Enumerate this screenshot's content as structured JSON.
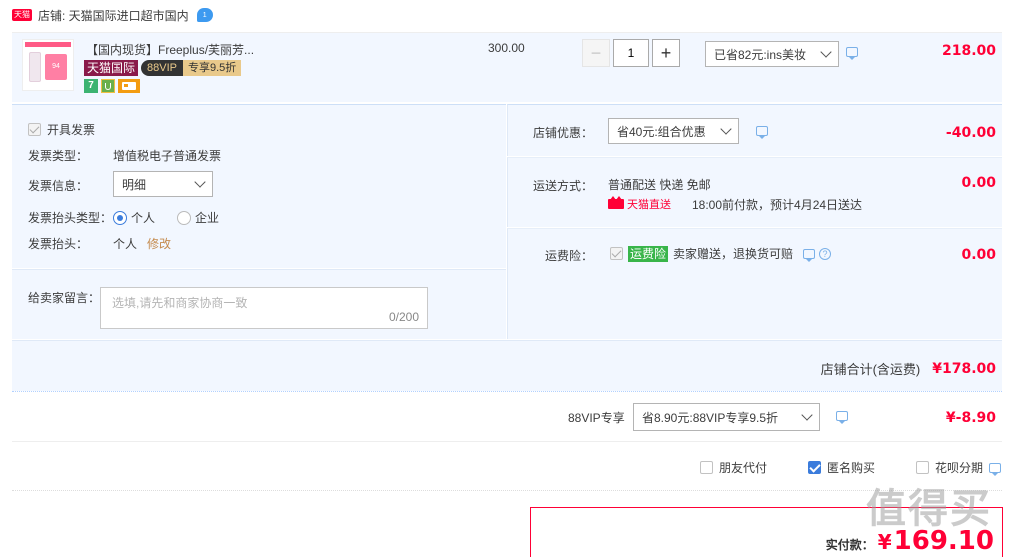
{
  "shop": {
    "badge": "天猫",
    "label": "店铺: 天猫国际进口超市国内",
    "msg_count": "1"
  },
  "item": {
    "title": "【国内现货】Freeplus/芙丽芳...",
    "tag_tmall_intl": "天猫国际",
    "tag_88vip": "88VIP",
    "tag_discount": "专享9.5折",
    "thumb_text": "94",
    "unit_price": "300.00",
    "qty": "1",
    "promo_select": "已省82元:ins美妆",
    "subtotal": "218.00"
  },
  "invoice": {
    "checkbox_label": "开具发票",
    "type_label": "发票类型：",
    "type_value": "增值税电子普通发票",
    "info_label": "发票信息：",
    "info_value": "明细",
    "title_type_label": "发票抬头类型：",
    "option_personal": "个人",
    "option_company": "企业",
    "title_label": "发票抬头：",
    "title_value": "个人",
    "modify_link": "修改"
  },
  "message": {
    "label": "给卖家留言：",
    "placeholder": "选填,请先和商家协商一致",
    "counter": "0/200"
  },
  "shop_discount": {
    "label": "店铺优惠：",
    "select": "省40元:组合优惠",
    "amount": "-40.00"
  },
  "shipping": {
    "label": "运送方式：",
    "method": "普通配送 快递 免邮",
    "direct_label": "天猫直送",
    "eta": "18:00前付款，预计4月24日送达",
    "amount": "0.00"
  },
  "insurance": {
    "label": "运费险：",
    "badge": "运费险",
    "text": "卖家赠送，退换货可赔",
    "amount": "0.00"
  },
  "shop_total": {
    "label": "店铺合计(含运费)",
    "amount": "¥178.00"
  },
  "vip": {
    "label": "88VIP专享",
    "select": "省8.90元:88VIP专享9.5折",
    "amount": "¥-8.90"
  },
  "options": {
    "friend_pay": "朋友代付",
    "anonymous": "匿名购买",
    "huabei": "花呗分期"
  },
  "payable": {
    "label": "实付款：",
    "currency": "¥",
    "amount": "169.10"
  },
  "watermark": "值得买",
  "colors": {
    "accent_red": "#ff0036",
    "accent_blue": "#3b7cdc",
    "panel_bg": "#f2f7ff"
  }
}
